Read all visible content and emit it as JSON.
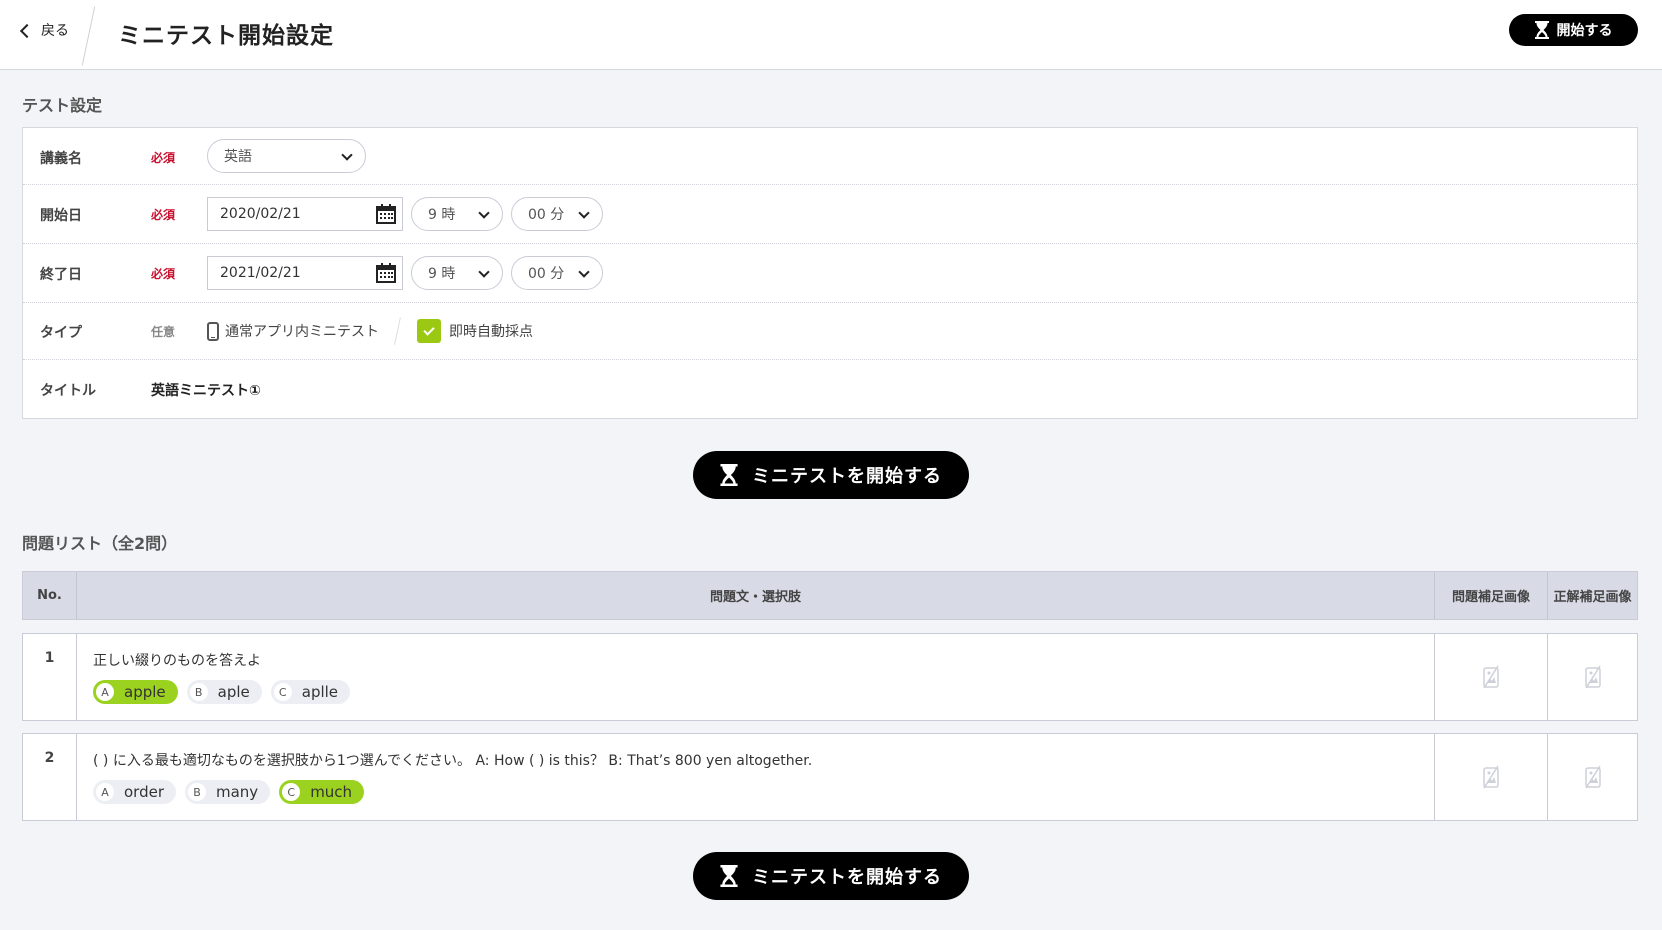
{
  "header": {
    "back_label": "戻る",
    "title": "ミニテスト開始設定",
    "start_label": "開始する"
  },
  "settings": {
    "section_title": "テスト設定",
    "required_label": "必須",
    "optional_label": "任意",
    "lecture": {
      "label": "講義名",
      "value": "英語"
    },
    "start_date": {
      "label": "開始日",
      "date": "2020/02/21",
      "hour": "9 時",
      "minute": "00 分"
    },
    "end_date": {
      "label": "終了日",
      "date": "2021/02/21",
      "hour": "9 時",
      "minute": "00 分"
    },
    "type": {
      "label": "タイプ",
      "app_type": "通常アプリ内ミニテスト",
      "auto_grade_label": "即時自動採点",
      "auto_grade_checked": true
    },
    "title_field": {
      "label": "タイトル",
      "value": "英語ミニテスト①"
    }
  },
  "start_test_label": "ミニテストを開始する",
  "questions": {
    "section_title": "問題リスト（全2問）",
    "columns": [
      "No.",
      "問題文・選択肢",
      "問題補足画像",
      "正解補足画像"
    ],
    "rows": [
      {
        "no": "1",
        "text": "正しい綴りのものを答えよ",
        "choices": [
          {
            "letter": "A",
            "text": "apple",
            "correct": true
          },
          {
            "letter": "B",
            "text": "aple",
            "correct": false
          },
          {
            "letter": "C",
            "text": "aplle",
            "correct": false
          }
        ]
      },
      {
        "no": "2",
        "text": "( ) に入る最も適切なものを選択肢から1つ選んでください。 A: How ( ) is this？ B: That’s 800 yen altogether.",
        "choices": [
          {
            "letter": "A",
            "text": "order",
            "correct": false
          },
          {
            "letter": "B",
            "text": "many",
            "correct": false
          },
          {
            "letter": "C",
            "text": "much",
            "correct": true
          }
        ]
      }
    ]
  },
  "colors": {
    "accent_green": "#9bd11f",
    "required_red": "#c8102e",
    "primary_black": "#000000"
  }
}
